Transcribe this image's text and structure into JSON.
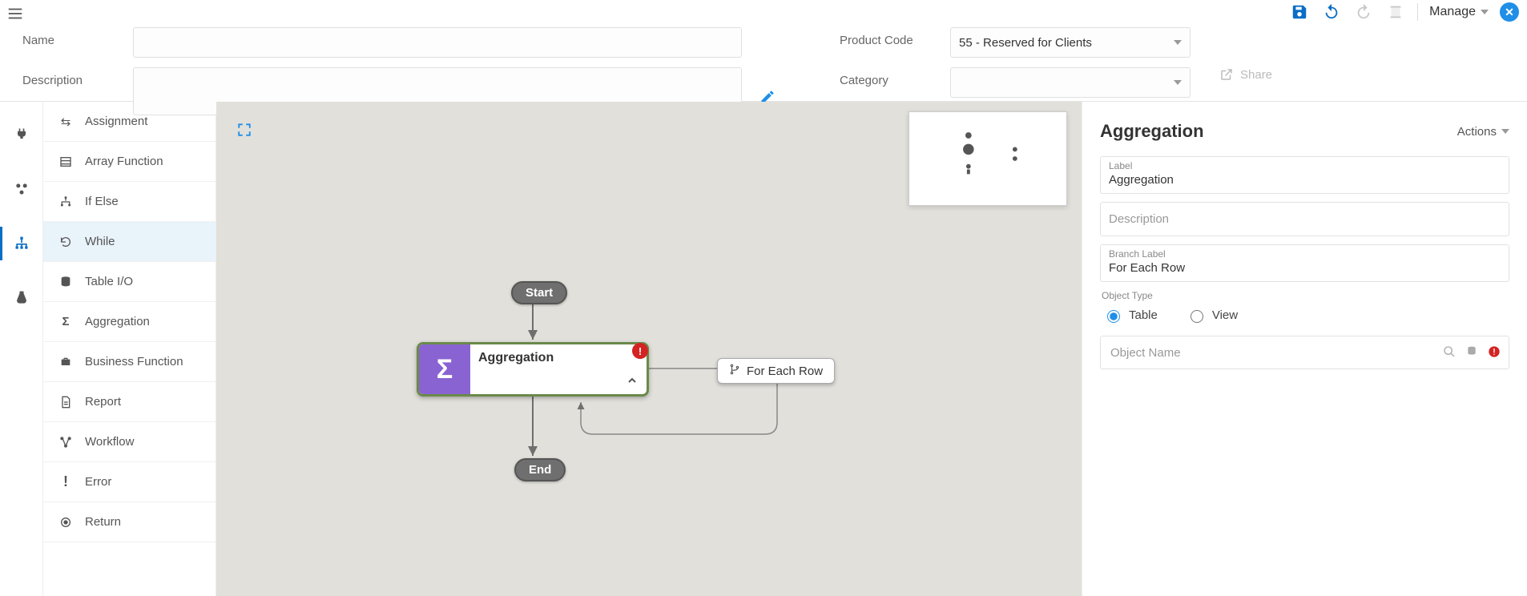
{
  "toolbar": {
    "manage_label": "Manage"
  },
  "header": {
    "name_label": "Name",
    "name_value": "",
    "description_label": "Description",
    "description_value": "",
    "product_code_label": "Product Code",
    "product_code_value": "55 - Reserved for Clients",
    "category_label": "Category",
    "category_value": "",
    "share_label": "Share"
  },
  "palette": {
    "items": [
      {
        "label": "Assignment"
      },
      {
        "label": "Array Function"
      },
      {
        "label": "If Else"
      },
      {
        "label": "While"
      },
      {
        "label": "Table I/O"
      },
      {
        "label": "Aggregation"
      },
      {
        "label": "Business Function"
      },
      {
        "label": "Report"
      },
      {
        "label": "Workflow"
      },
      {
        "label": "Error"
      },
      {
        "label": "Return"
      }
    ]
  },
  "canvas": {
    "start_label": "Start",
    "end_label": "End",
    "agg_node_title": "Aggregation",
    "branch_label": "For Each Row"
  },
  "properties": {
    "panel_title": "Aggregation",
    "actions_label": "Actions",
    "label_field_label": "Label",
    "label_field_value": "Aggregation",
    "description_placeholder": "Description",
    "branch_label_label": "Branch Label",
    "branch_label_value": "For Each Row",
    "object_type_label": "Object Type",
    "radio_table": "Table",
    "radio_view": "View",
    "object_name_placeholder": "Object Name"
  }
}
